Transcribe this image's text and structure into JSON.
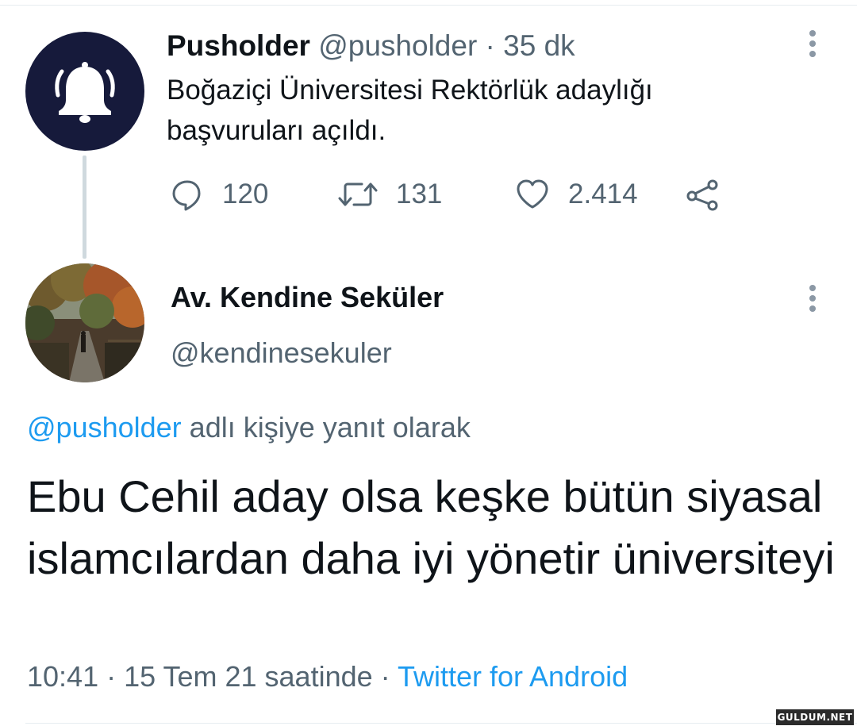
{
  "parent_tweet": {
    "display_name": "Pusholder",
    "handle": "@pusholder",
    "separator": " · ",
    "time_ago": "35 dk",
    "text": "Boğaziçi Üniversitesi Rektörlük adaylığı başvuruları açıldı.",
    "avatar_icon": "bell-icon",
    "stats": {
      "replies": "120",
      "retweets": "131",
      "likes": "2.414"
    }
  },
  "reply_tweet": {
    "display_name": "Av. Kendine Seküler",
    "handle": "@kendinesekuler",
    "replying_to_mention": "@pusholder",
    "replying_to_suffix": " adlı kişiye yanıt olarak",
    "text": "Ebu Cehil aday olsa keşke bütün siyasal islamcılardan daha iyi yönetir üniversiteyi",
    "timestamp": "10:41 · 15 Tem 21 saatinde",
    "meta_separator": " · ",
    "source": "Twitter for Android"
  },
  "watermark": "GULDUM.NET",
  "colors": {
    "text_primary": "#0f1419",
    "text_secondary": "#536471",
    "link": "#1d9bf0",
    "avatar_bg": "#161a3b"
  }
}
